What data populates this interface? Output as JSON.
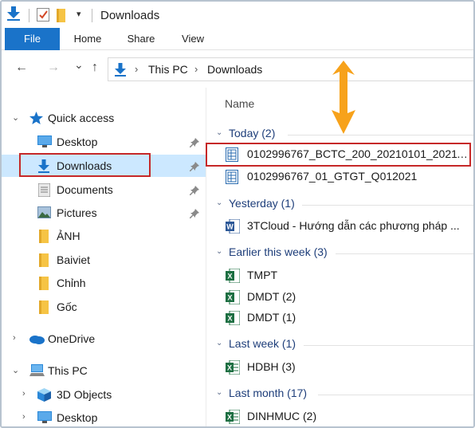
{
  "window": {
    "title": "Downloads"
  },
  "quick_access_toolbar": {
    "icons": [
      "download-arrow-icon",
      "properties-check-icon",
      "new-folder-icon",
      "customize-dropdown-icon"
    ],
    "dropdown_glyph": "▾"
  },
  "ribbon": {
    "tabs": [
      {
        "label": "File",
        "active": true
      },
      {
        "label": "Home"
      },
      {
        "label": "Share"
      },
      {
        "label": "View"
      }
    ]
  },
  "address_bar": {
    "back": "←",
    "forward": "→",
    "recent": "⌄",
    "up": "↑",
    "breadcrumb": [
      "This PC",
      "Downloads"
    ],
    "separator": "›"
  },
  "nav_pane": {
    "quick_access": {
      "label": "Quick access",
      "expanded": true
    },
    "pinned": [
      {
        "label": "Desktop",
        "icon": "desktop-icon",
        "pinned": true
      },
      {
        "label": "Downloads",
        "icon": "downloads-icon",
        "pinned": true,
        "selected": true
      },
      {
        "label": "Documents",
        "icon": "documents-icon",
        "pinned": true
      },
      {
        "label": "Pictures",
        "icon": "pictures-icon",
        "pinned": true
      }
    ],
    "folders": [
      {
        "label": "ẢNH",
        "icon": "folder-icon"
      },
      {
        "label": "Baiviet",
        "icon": "folder-icon"
      },
      {
        "label": "Chỉnh",
        "icon": "folder-icon"
      },
      {
        "label": "Gốc",
        "icon": "folder-icon"
      }
    ],
    "onedrive": {
      "label": "OneDrive",
      "icon": "onedrive-cloud-icon"
    },
    "this_pc": {
      "label": "This PC",
      "icon": "this-pc-icon",
      "expanded": true
    },
    "this_pc_children": [
      {
        "label": "3D Objects",
        "icon": "3d-objects-icon"
      },
      {
        "label": "Desktop",
        "icon": "desktop-icon"
      }
    ]
  },
  "content": {
    "column_header": "Name",
    "groups": [
      {
        "label": "Today (2)",
        "files": [
          {
            "name": "0102996767_BCTC_200_20210101_20211...",
            "icon": "xml-document-icon",
            "highlighted": true
          },
          {
            "name": "0102996767_01_GTGT_Q012021",
            "icon": "xml-document-icon"
          }
        ]
      },
      {
        "label": "Yesterday (1)",
        "files": [
          {
            "name": "3TCloud - Hướng dẫn các phương pháp ...",
            "icon": "word-document-icon"
          }
        ]
      },
      {
        "label": "Earlier this week (3)",
        "files": [
          {
            "name": "TMPT",
            "icon": "excel-icon"
          },
          {
            "name": "DMDT (2)",
            "icon": "excel-icon"
          },
          {
            "name": "DMDT (1)",
            "icon": "excel-icon"
          }
        ]
      },
      {
        "label": "Last week (1)",
        "files": [
          {
            "name": "HDBH (3)",
            "icon": "excel-sheet-icon"
          }
        ]
      },
      {
        "label": "Last month (17)",
        "files": [
          {
            "name": "DINHMUC (2)",
            "icon": "excel-sheet-icon"
          }
        ]
      }
    ]
  },
  "colors": {
    "accent_blue": "#1a73c9",
    "selection": "#cce8ff",
    "highlight_red": "#c62828",
    "arrow_orange": "#f7a21b",
    "group_blue": "#1e3e7a",
    "excel_green": "#1d6f42",
    "word_blue": "#2b5797"
  }
}
